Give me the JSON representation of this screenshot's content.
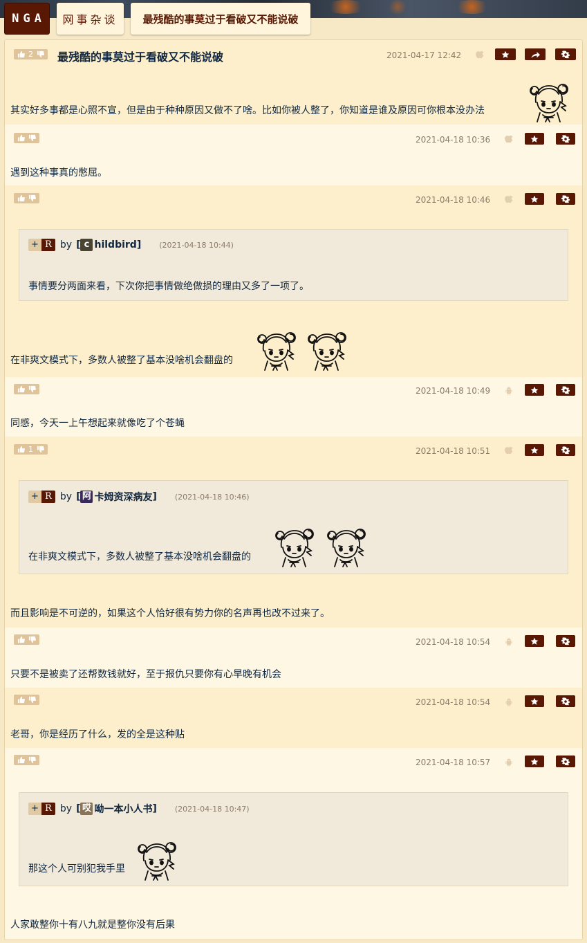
{
  "nav": {
    "logo": "NGA",
    "forum": "网事杂谈",
    "topic": "最残酷的事莫过于看破又不能说破"
  },
  "colors": {
    "brand": "#591804",
    "text": "#10273f",
    "meta": "#8a7b67",
    "vote": "#dfc49b"
  },
  "icons": {
    "upvote": "thumbs-up-icon",
    "downvote": "thumbs-down-icon",
    "favorite": "star-icon",
    "share": "share-arrow-icon",
    "manage": "gear-icon",
    "device_apple": "apple-icon",
    "device_android": "android-icon"
  },
  "posts": [
    {
      "votes": "2",
      "title": "最残酷的事莫过于看破又不能说破",
      "date": "2021-04-17 12:42",
      "device": "apple",
      "text": "其实好多事都是心照不宣，但是由于种种原因又做不了啥。比如你被人整了，你知道是谁及原因可你根本没办法"
    },
    {
      "votes": "",
      "date": "2021-04-18 10:36",
      "device": "apple",
      "text": "遇到这种事真的憋屈。"
    },
    {
      "votes": "",
      "date": "2021-04-18 10:46",
      "device": "apple",
      "quote": {
        "plus": "+",
        "r": "R",
        "by": "by",
        "badge": "c",
        "name": "childbird",
        "name_rest": "hildbird",
        "time": "(2021-04-18 10:44)",
        "text": "事情要分两面来看，下次你把事情做绝做损的理由又多了一项了。"
      },
      "text": "在非爽文模式下，多数人被整了基本没啥机会翻盘的"
    },
    {
      "votes": "",
      "date": "2021-04-18 10:49",
      "device": "android",
      "text": "同感，今天一上午想起来就像吃了个苍蝇"
    },
    {
      "votes": "1",
      "date": "2021-04-18 10:51",
      "device": "apple",
      "quote": {
        "plus": "+",
        "r": "R",
        "by": "by",
        "badge": "阿",
        "name_rest": "卡姆资深病友",
        "time": "(2021-04-18 10:46)",
        "text": "在非爽文模式下，多数人被整了基本没啥机会翻盘的"
      },
      "text": "而且影响是不可逆的，如果这个人恰好很有势力你的名声再也改不过来了。"
    },
    {
      "votes": "",
      "date": "2021-04-18 10:54",
      "device": "android",
      "text": "只要不是被卖了还帮数钱就好，至于报仇只要你有心早晚有机会"
    },
    {
      "votes": "",
      "date": "2021-04-18 10:54",
      "device": "android",
      "text": "老哥，你是经历了什么，发的全是这种贴"
    },
    {
      "votes": "",
      "date": "2021-04-18 10:57",
      "device": "android",
      "quote": {
        "plus": "+",
        "r": "R",
        "by": "by",
        "badge": "哎",
        "name_rest": "呦一本小人书",
        "time": "(2021-04-18 10:47)",
        "text": "那这个人可别犯我手里"
      },
      "text": "人家敢整你十有八九就是整你没有后果"
    }
  ]
}
